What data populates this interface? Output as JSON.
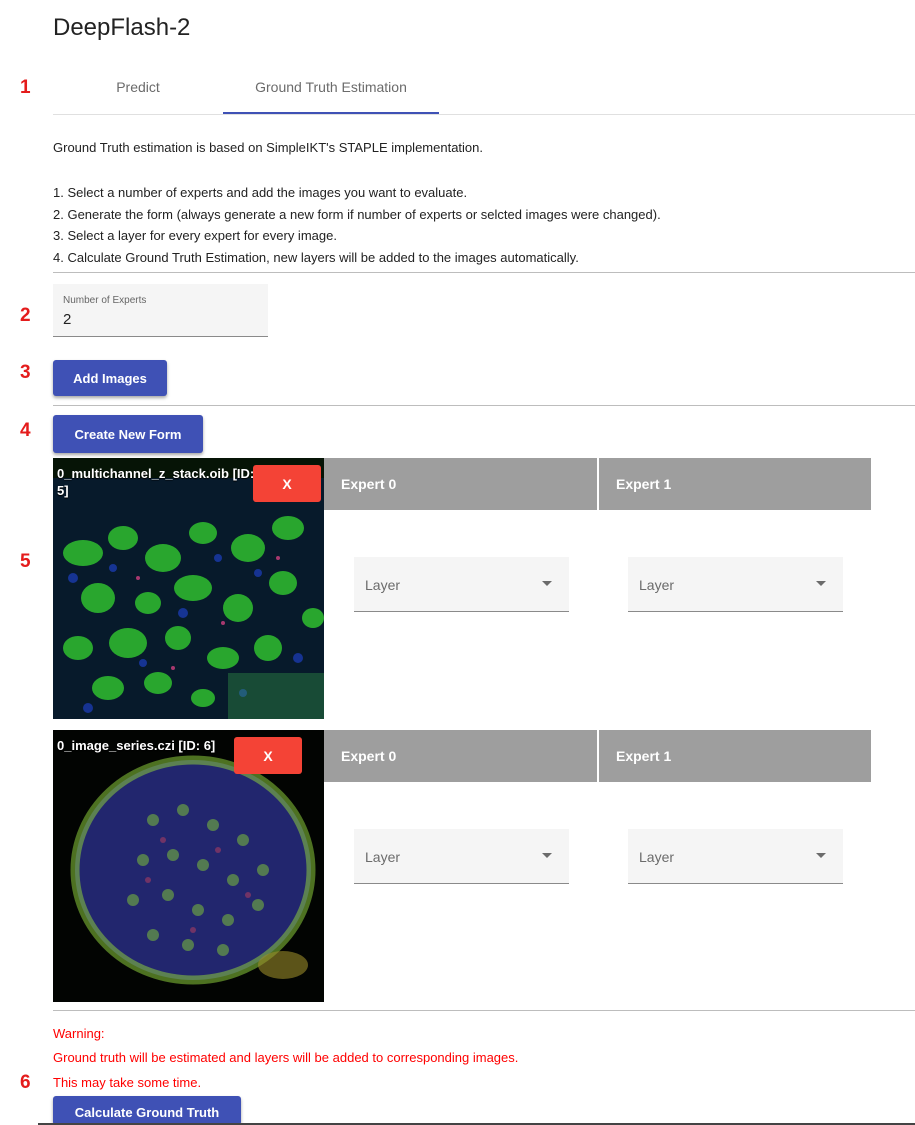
{
  "app": {
    "title": "DeepFlash-2"
  },
  "annotations": [
    "1",
    "2",
    "3",
    "4",
    "5",
    "6"
  ],
  "tabs": [
    {
      "label": "Predict",
      "active": false
    },
    {
      "label": "Ground Truth Estimation",
      "active": true
    }
  ],
  "colors": {
    "accent": "#3f51b5",
    "danger": "#f44336",
    "warning_text": "#ff0000",
    "header_gray": "#9e9e9e",
    "annotation": "#e41c1c"
  },
  "intro": "Ground Truth estimation is based on SimpleIKT's STAPLE implementation.",
  "steps": [
    "1. Select a number of experts and add the images you want to evaluate.",
    "2. Generate the form (always generate a new form if number of experts or selcted images were changed).",
    "3. Select a layer for every expert for every image.",
    "4. Calculate Ground Truth Estimation, new layers will be added to the images automatically."
  ],
  "experts_field": {
    "label": "Number of Experts",
    "value": "2"
  },
  "buttons": {
    "add_images": "Add Images",
    "create_form": "Create New Form",
    "calculate": "Calculate Ground Truth",
    "remove": "X"
  },
  "images": [
    {
      "name": "0_multichannel_z_stack.oib [ID: 5]",
      "experts": [
        {
          "header": "Expert 0",
          "select_placeholder": "Layer"
        },
        {
          "header": "Expert 1",
          "select_placeholder": "Layer"
        }
      ]
    },
    {
      "name": "0_image_series.czi [ID: 6]",
      "experts": [
        {
          "header": "Expert 0",
          "select_placeholder": "Layer"
        },
        {
          "header": "Expert 1",
          "select_placeholder": "Layer"
        }
      ]
    }
  ],
  "warning": {
    "title": "Warning:",
    "line1": "Ground truth will be estimated and layers will be added to corresponding images.",
    "line2": "This may take some time."
  }
}
